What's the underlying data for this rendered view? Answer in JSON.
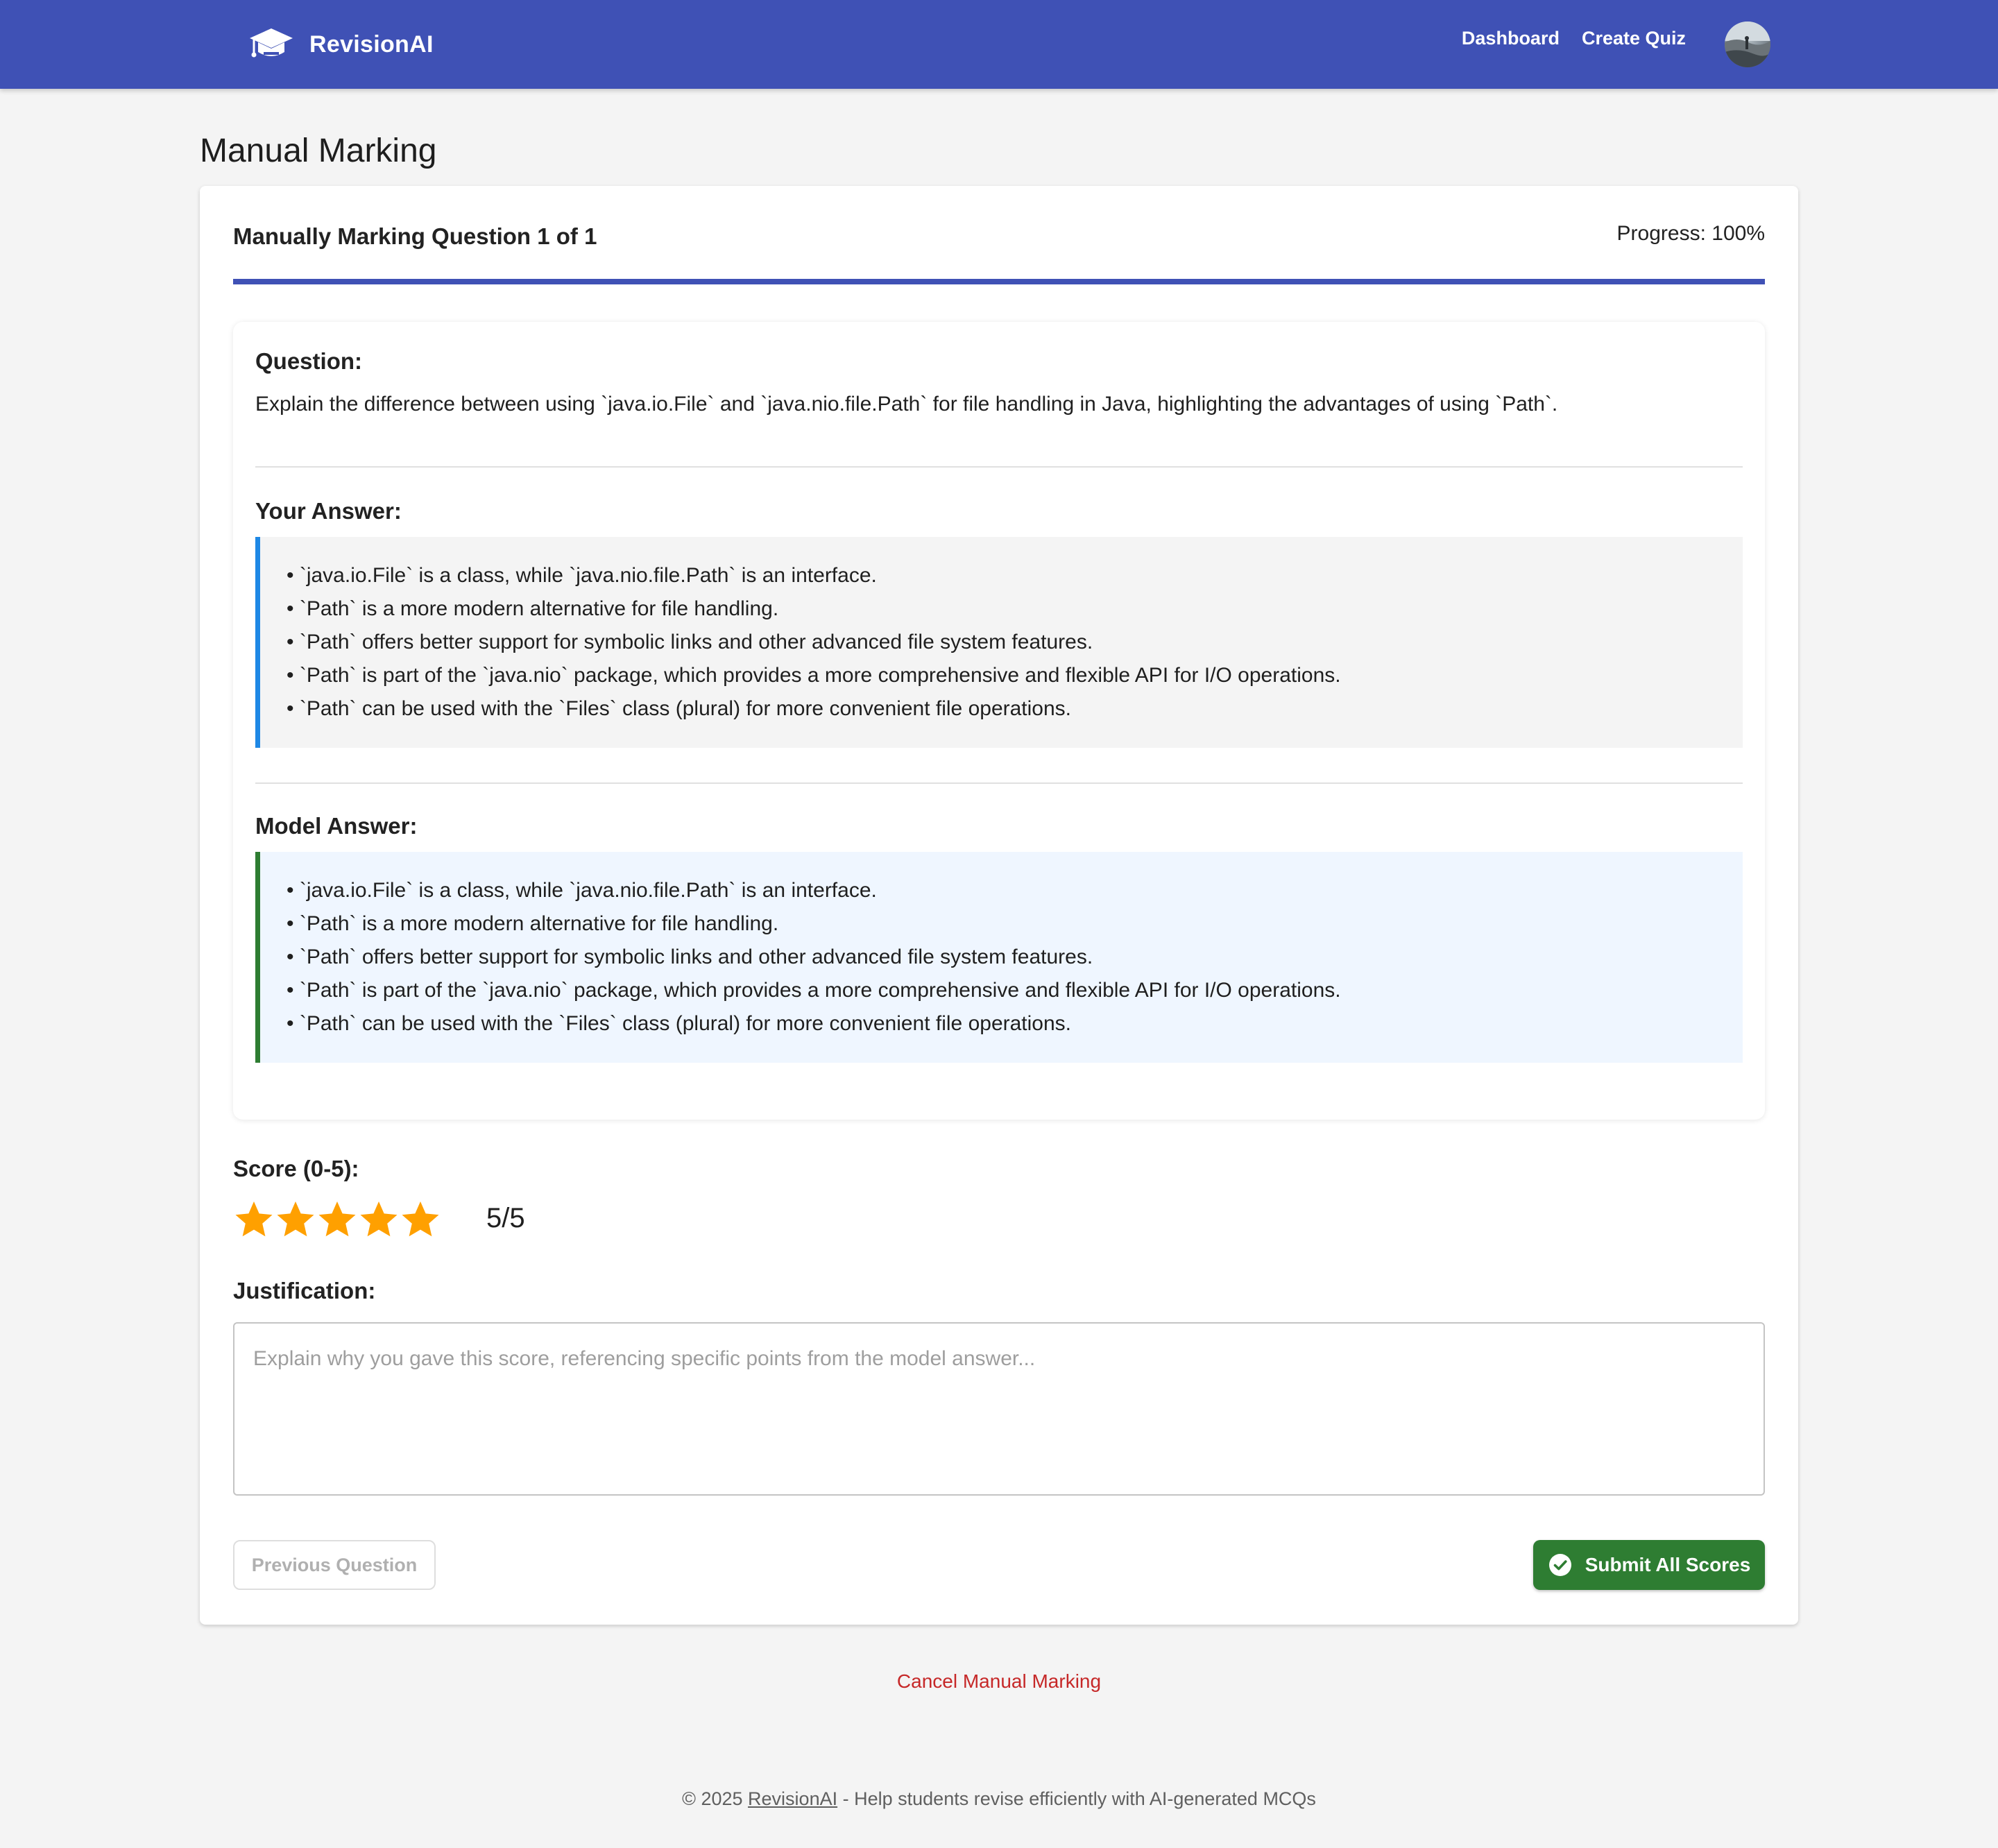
{
  "header": {
    "app_name": "RevisionAI",
    "nav": [
      "Dashboard",
      "Create Quiz"
    ]
  },
  "page_title": "Manual Marking",
  "card": {
    "marking_title": "Manually Marking Question 1 of 1",
    "progress_text": "Progress: 100%",
    "progress_value": 100
  },
  "question": {
    "label": "Question:",
    "text": "Explain the difference between using `java.io.File` and `java.nio.file.Path` for file handling in Java, highlighting the advantages of using `Path`."
  },
  "your_answer": {
    "label": "Your Answer:",
    "items": [
      "`java.io.File` is a class, while `java.nio.file.Path` is an interface.",
      "`Path` is a more modern alternative for file handling.",
      "`Path` offers better support for symbolic links and other advanced file system features.",
      "`Path` is part of the `java.nio` package, which provides a more comprehensive and flexible API for I/O operations.",
      "`Path` can be used with the `Files` class (plural) for more convenient file operations."
    ]
  },
  "model_answer": {
    "label": "Model Answer:",
    "items": [
      "`java.io.File` is a class, while `java.nio.file.Path` is an interface.",
      "`Path` is a more modern alternative for file handling.",
      "`Path` offers better support for symbolic links and other advanced file system features.",
      "`Path` is part of the `java.nio` package, which provides a more comprehensive and flexible API for I/O operations.",
      "`Path` can be used with the `Files` class (plural) for more convenient file operations."
    ]
  },
  "score": {
    "label": "Score (0-5):",
    "value": 5,
    "max": 5,
    "display": "5/5"
  },
  "justification": {
    "label": "Justification:",
    "value": "",
    "placeholder": "Explain why you gave this score, referencing specific points from the model answer..."
  },
  "buttons": {
    "previous": "Previous Question",
    "submit": "Submit All Scores",
    "cancel": "Cancel Manual Marking"
  },
  "footer": {
    "prefix": "© 2025",
    "link": "RevisionAI",
    "suffix": "- Help students revise efficiently with AI-generated MCQs"
  },
  "colors": {
    "primary": "#3f51b5",
    "success": "#2e7d32",
    "star": "#ffa000",
    "danger": "#c62828",
    "your_answer_border": "#1e88e5",
    "model_answer_border": "#2e7d32"
  },
  "icons": {
    "brand": "graduation-cap-icon",
    "submit": "check-circle-icon",
    "rating": "star-icon"
  }
}
